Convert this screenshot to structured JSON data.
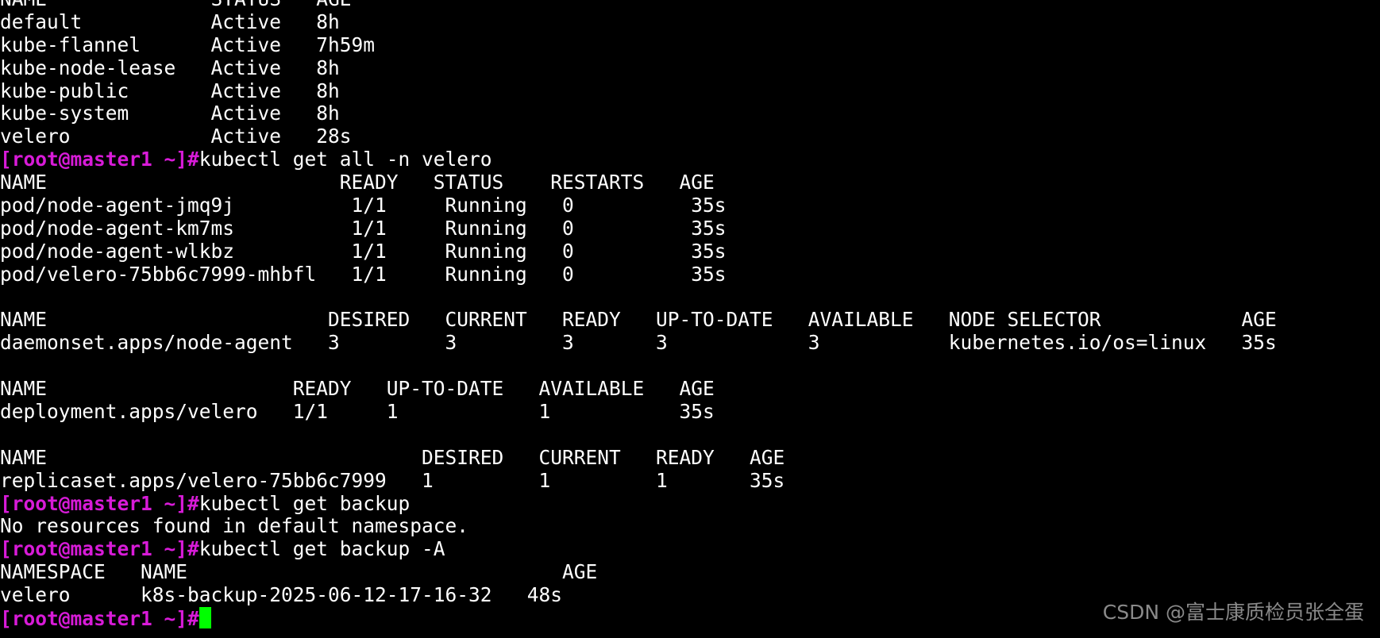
{
  "terminal": {
    "lines": [
      {
        "type": "out",
        "text": "NAME              STATUS   AGE"
      },
      {
        "type": "out",
        "text": "default           Active   8h"
      },
      {
        "type": "out",
        "text": "kube-flannel      Active   7h59m"
      },
      {
        "type": "out",
        "text": "kube-node-lease   Active   8h"
      },
      {
        "type": "out",
        "text": "kube-public       Active   8h"
      },
      {
        "type": "out",
        "text": "kube-system       Active   8h"
      },
      {
        "type": "out",
        "text": "velero            Active   28s"
      },
      {
        "type": "cmd",
        "prompt": "[root@master1 ~]#",
        "text": "kubectl get all -n velero"
      },
      {
        "type": "out",
        "text": "NAME                         READY   STATUS    RESTARTS   AGE"
      },
      {
        "type": "out",
        "text": "pod/node-agent-jmq9j          1/1     Running   0          35s"
      },
      {
        "type": "out",
        "text": "pod/node-agent-km7ms          1/1     Running   0          35s"
      },
      {
        "type": "out",
        "text": "pod/node-agent-wlkbz          1/1     Running   0          35s"
      },
      {
        "type": "out",
        "text": "pod/velero-75bb6c7999-mhbfl   1/1     Running   0          35s"
      },
      {
        "type": "out",
        "text": ""
      },
      {
        "type": "out",
        "text": "NAME                        DESIRED   CURRENT   READY   UP-TO-DATE   AVAILABLE   NODE SELECTOR            AGE"
      },
      {
        "type": "out",
        "text": "daemonset.apps/node-agent   3         3         3       3            3           kubernetes.io/os=linux   35s"
      },
      {
        "type": "out",
        "text": ""
      },
      {
        "type": "out",
        "text": "NAME                     READY   UP-TO-DATE   AVAILABLE   AGE"
      },
      {
        "type": "out",
        "text": "deployment.apps/velero   1/1     1            1           35s"
      },
      {
        "type": "out",
        "text": ""
      },
      {
        "type": "out",
        "text": "NAME                                DESIRED   CURRENT   READY   AGE"
      },
      {
        "type": "out",
        "text": "replicaset.apps/velero-75bb6c7999   1         1         1       35s"
      },
      {
        "type": "cmd",
        "prompt": "[root@master1 ~]#",
        "text": "kubectl get backup"
      },
      {
        "type": "out",
        "text": "No resources found in default namespace."
      },
      {
        "type": "cmd",
        "prompt": "[root@master1 ~]#",
        "text": "kubectl get backup -A"
      },
      {
        "type": "out",
        "text": "NAMESPACE   NAME                                AGE"
      },
      {
        "type": "out",
        "text": "velero      k8s-backup-2025-06-12-17-16-32   48s"
      },
      {
        "type": "cmd",
        "prompt": "[root@master1 ~]#",
        "text": "",
        "cursor": true
      }
    ]
  },
  "watermark": "CSDN @富士康质检员张全蛋",
  "colors": {
    "background": "#000000",
    "foreground": "#ffffff",
    "prompt": "#d81bd8",
    "cursor": "#00ff00",
    "watermark": "#8a8a8a"
  }
}
